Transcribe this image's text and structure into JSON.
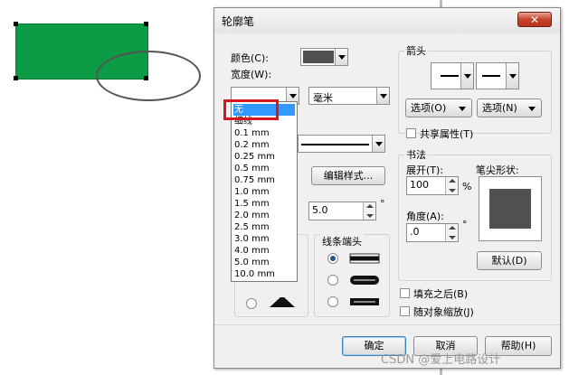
{
  "dialog": {
    "title": "轮廓笔",
    "close_label": "✕",
    "color_label": "颜色(C):",
    "color_value": "#505050",
    "width_label": "宽度(W):",
    "unit_value": "毫米",
    "edit_style_label": "编辑样式...",
    "angle_value": "5.0",
    "degree_symbol": "°",
    "line_caps_label": "线条端头",
    "arrows_label": "箭头",
    "options_left_label": "选项(O)",
    "options_right_label": "选项(N)",
    "shared_attr_label": "共享属性(T)",
    "calligraphy_label": "书法",
    "stretch_label": "展开(T):",
    "stretch_value": "100",
    "percent_symbol": "%",
    "nib_shape_label": "笔尖形状:",
    "angle_label": "角度(A):",
    "nib_angle_value": ".0",
    "default_button_label": "默认(D)",
    "fill_after_label": "填充之后(B)",
    "scale_with_label": "随对象缩放(J)",
    "ok_label": "确定",
    "cancel_label": "取消",
    "help_label": "帮助(H)"
  },
  "width_options": [
    "无",
    "细线",
    "0.1 mm",
    "0.2 mm",
    "0.25 mm",
    "0.5 mm",
    "0.75 mm",
    "1.0 mm",
    "1.5 mm",
    "2.0 mm",
    "2.5 mm",
    "3.0 mm",
    "4.0 mm",
    "5.0 mm",
    "10.0 mm"
  ],
  "selected_width_index": 0,
  "canvas": {
    "rect_fill": "#0e9b45",
    "accent": "#3399ff",
    "highlight": "#d7151d"
  },
  "watermark": "CSDN @爱上电路设计"
}
